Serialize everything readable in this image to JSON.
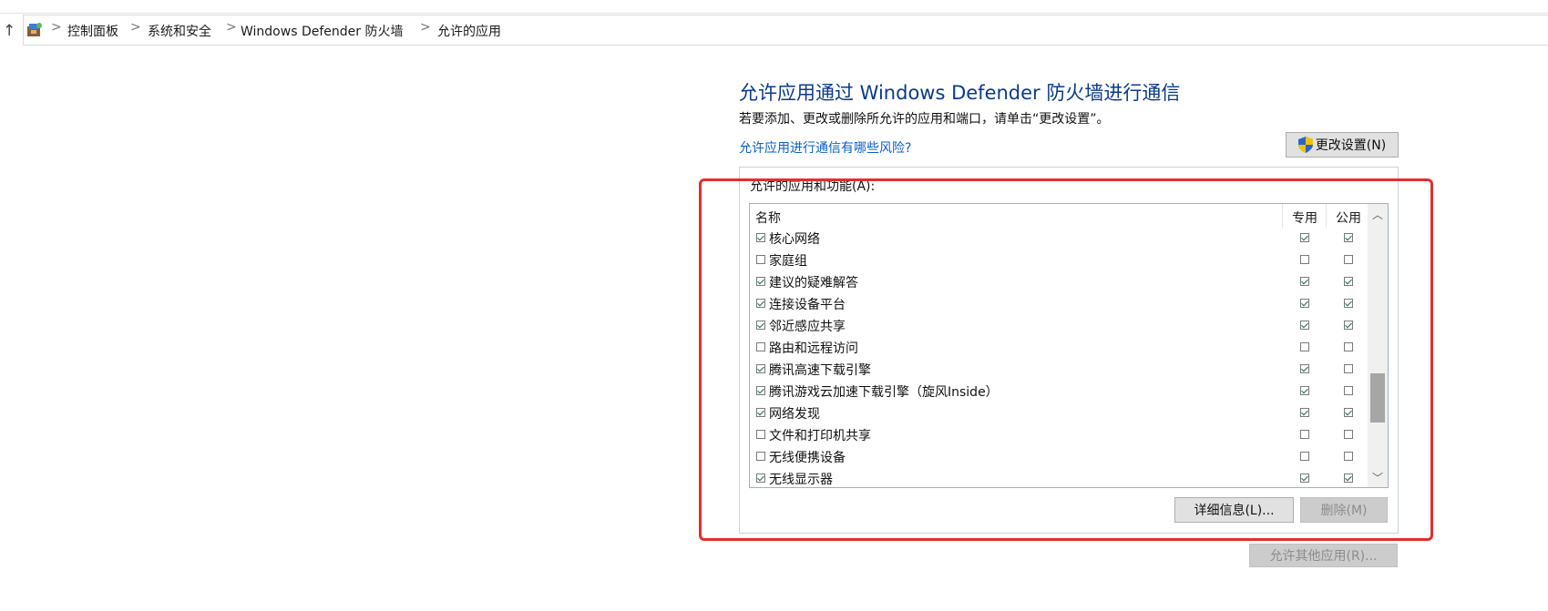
{
  "breadcrumb": {
    "items": [
      "控制面板",
      "系统和安全",
      "Windows Defender 防火墙",
      "允许的应用"
    ],
    "separator": ">"
  },
  "nav": {
    "up_icon": "↑"
  },
  "header": {
    "title": "允许应用通过 Windows Defender 防火墙进行通信",
    "description": "若要添加、更改或删除所允许的应用和端口，请单击“更改设置”。",
    "risk_link": "允许应用进行通信有哪些风险?",
    "change_settings_label": "更改设置(N)"
  },
  "group": {
    "label": "允许的应用和功能(A):"
  },
  "list": {
    "columns": {
      "name": "名称",
      "private": "专用",
      "public": "公用"
    },
    "rows": [
      {
        "name": "核心网络",
        "enabled": true,
        "private": true,
        "public": true
      },
      {
        "name": "家庭组",
        "enabled": false,
        "private": false,
        "public": false
      },
      {
        "name": "建议的疑难解答",
        "enabled": true,
        "private": true,
        "public": true
      },
      {
        "name": "连接设备平台",
        "enabled": true,
        "private": true,
        "public": true
      },
      {
        "name": "邻近感应共享",
        "enabled": true,
        "private": true,
        "public": true
      },
      {
        "name": "路由和远程访问",
        "enabled": false,
        "private": false,
        "public": false
      },
      {
        "name": "腾讯高速下载引擎",
        "enabled": true,
        "private": true,
        "public": false
      },
      {
        "name": "腾讯游戏云加速下载引擎（旋风Inside）",
        "enabled": true,
        "private": true,
        "public": false
      },
      {
        "name": "网络发现",
        "enabled": true,
        "private": true,
        "public": true
      },
      {
        "name": "文件和打印机共享",
        "enabled": false,
        "private": false,
        "public": false
      },
      {
        "name": "无线便携设备",
        "enabled": false,
        "private": false,
        "public": false
      },
      {
        "name": "无线显示器",
        "enabled": true,
        "private": true,
        "public": true
      }
    ]
  },
  "buttons": {
    "details": "详细信息(L)...",
    "delete": "删除(M)",
    "allow_other": "允许其他应用(R)..."
  },
  "colors": {
    "title": "#0b3a8c",
    "link": "#0a5fc9",
    "highlight": "#e52d2d",
    "check": "#1a6e41"
  },
  "icons": {
    "address": "control-panel-icon",
    "shield": "uac-shield-icon",
    "scroll_up": "chevron-up-icon",
    "scroll_down": "chevron-down-icon"
  }
}
